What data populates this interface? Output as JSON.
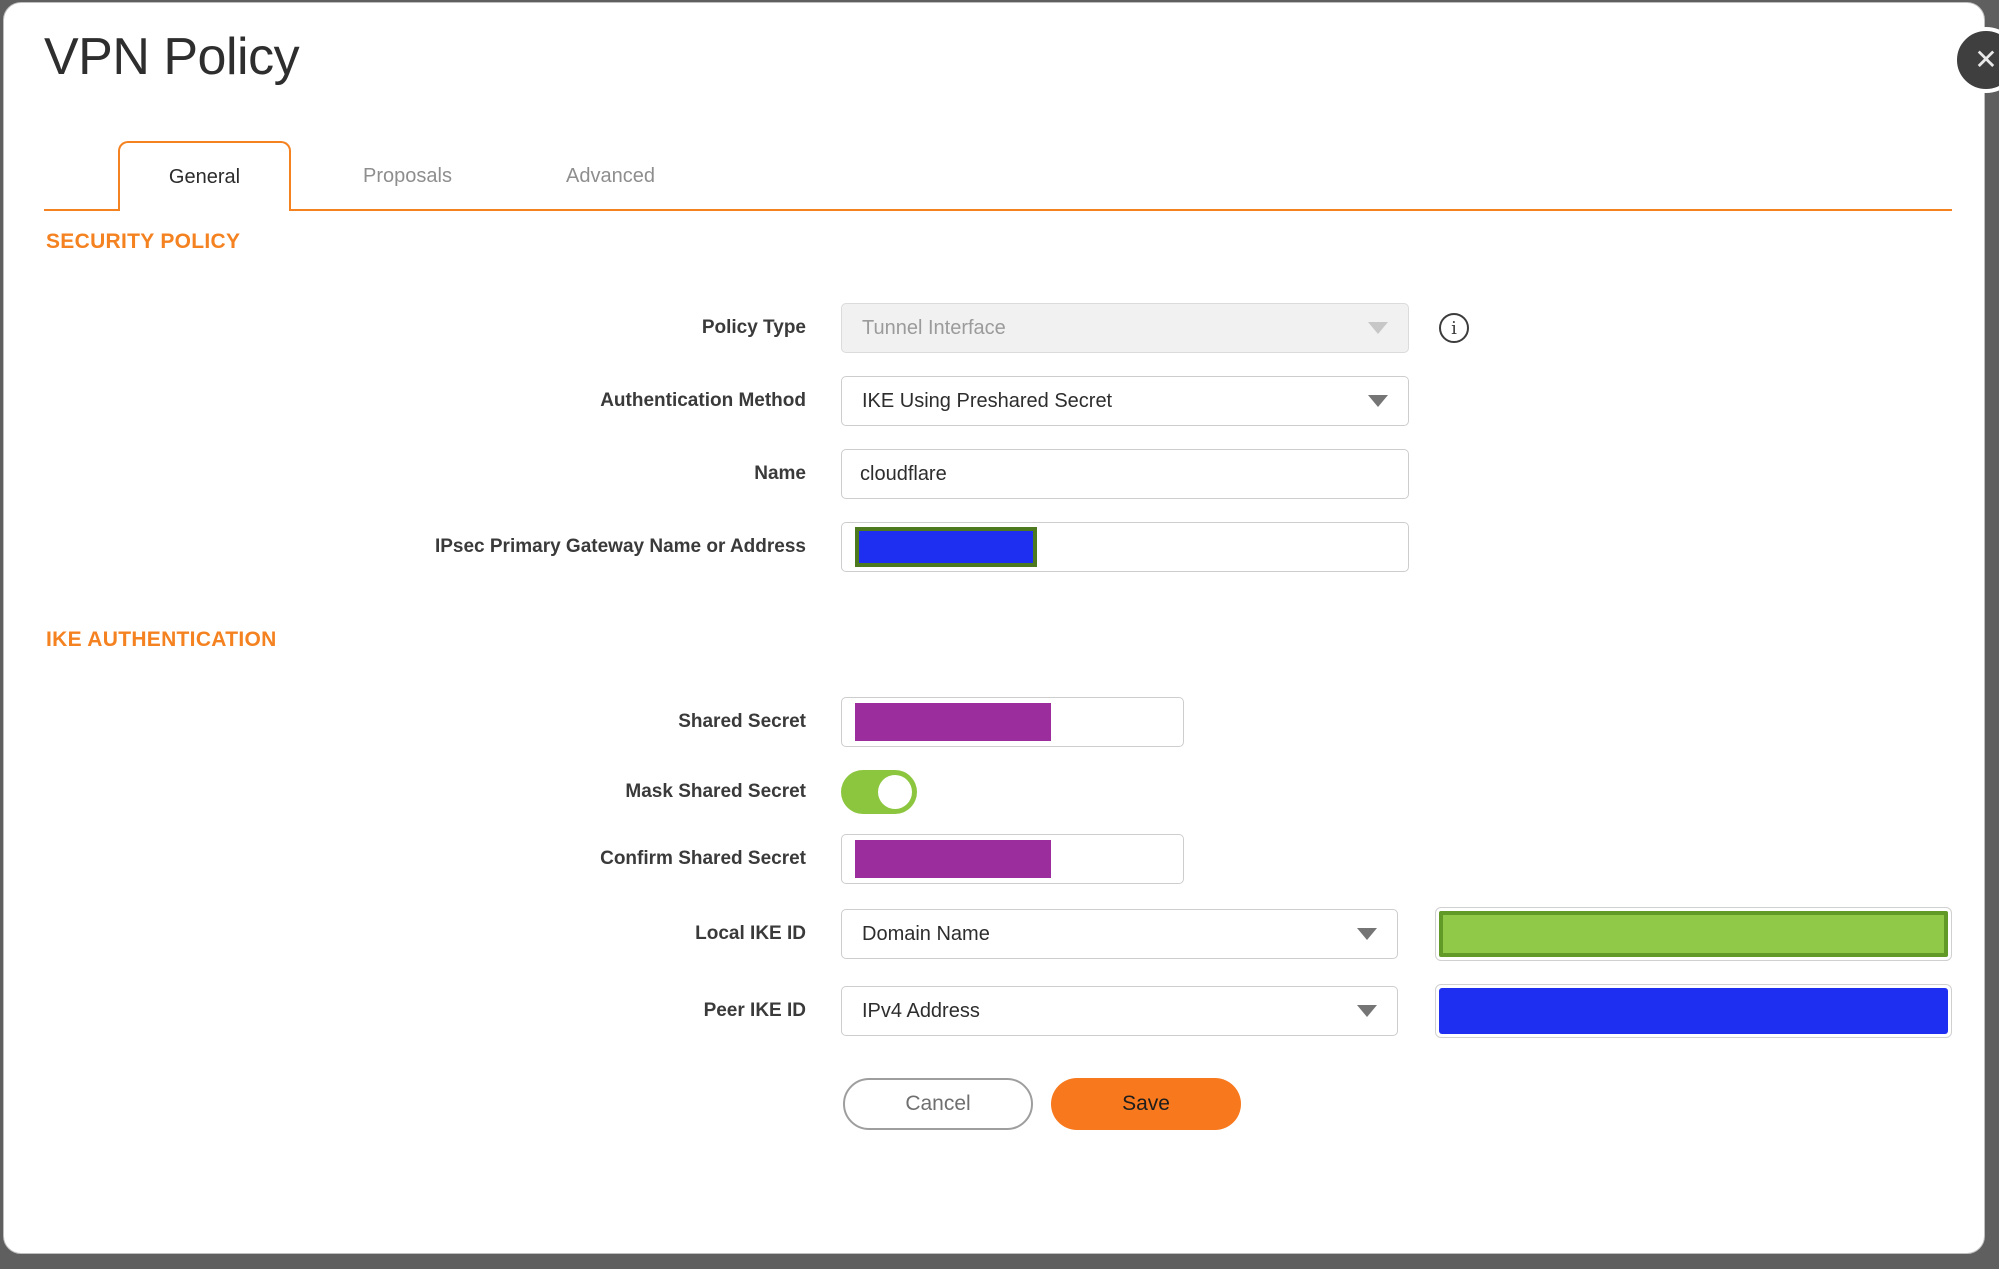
{
  "dialog": {
    "title": "VPN Policy"
  },
  "tabs": [
    {
      "label": "General",
      "active": true
    },
    {
      "label": "Proposals",
      "active": false
    },
    {
      "label": "Advanced",
      "active": false
    }
  ],
  "security_policy": {
    "heading": "SECURITY POLICY",
    "policy_type": {
      "label": "Policy Type",
      "value": "Tunnel Interface",
      "disabled": true
    },
    "authentication_method": {
      "label": "Authentication Method",
      "value": "IKE Using Preshared Secret"
    },
    "name": {
      "label": "Name",
      "value": "cloudflare"
    },
    "gateway": {
      "label": "IPsec Primary Gateway Name or Address",
      "value": "",
      "redacted": "blue"
    }
  },
  "ike_authentication": {
    "heading": "IKE AUTHENTICATION",
    "shared_secret": {
      "label": "Shared Secret",
      "redacted": "purple"
    },
    "mask_shared_secret": {
      "label": "Mask Shared Secret",
      "state": "on"
    },
    "confirm_shared_secret": {
      "label": "Confirm Shared Secret",
      "redacted": "purple"
    },
    "local_ike_id": {
      "label": "Local IKE ID",
      "value": "Domain Name",
      "redacted": "green"
    },
    "peer_ike_id": {
      "label": "Peer IKE ID",
      "value": "IPv4 Address",
      "redacted": "blue"
    }
  },
  "actions": {
    "cancel": "Cancel",
    "save": "Save"
  },
  "icons": {
    "close": "✕",
    "info": "i"
  },
  "colors": {
    "accent_orange": "#F58220",
    "save_button_orange": "#F8791D",
    "toggle_on_green": "#8CC63F",
    "redaction_blue": "#1E2FF2",
    "redaction_purple": "#9C2D9C",
    "redaction_green_fill": "#90C848",
    "redaction_green_border": "#619A27"
  }
}
